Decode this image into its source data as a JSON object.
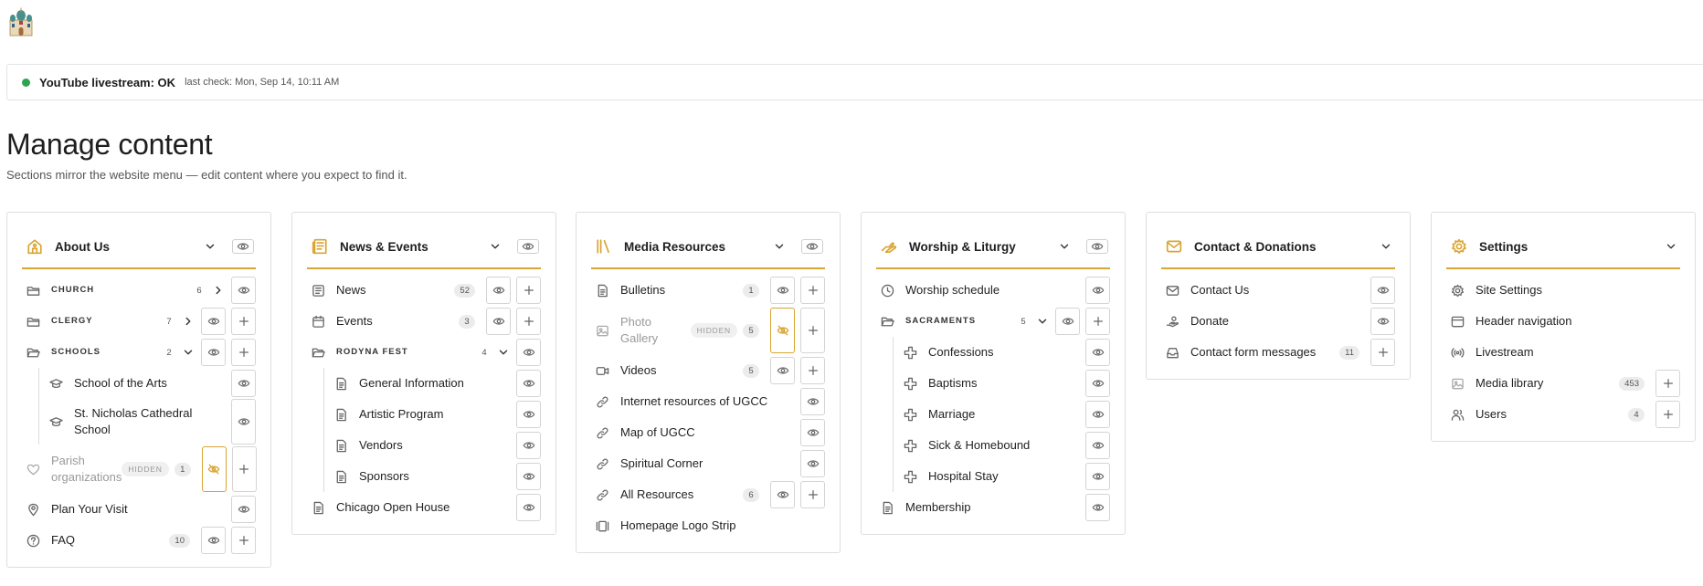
{
  "status": {
    "main": "YouTube livestream: OK",
    "sub": "last check: Mon, Sep 14, 10:11 AM"
  },
  "page": {
    "title": "Manage content",
    "subtitle": "Sections mirror the website menu — edit content where you expect to find it."
  },
  "colors": {
    "accent": "#d9a534",
    "status_ok": "#2ea44f"
  },
  "cards": {
    "about": {
      "title": "About Us",
      "church": {
        "label": "CHURCH",
        "count": "6"
      },
      "clergy": {
        "label": "CLERGY",
        "count": "7"
      },
      "schools": {
        "label": "SCHOOLS",
        "count": "2"
      },
      "arts": "School of the Arts",
      "cathedral": "St. Nicholas Cathedral School",
      "parish": {
        "label": "Parish organizations",
        "badge": "HIDDEN",
        "count": "1"
      },
      "visit": "Plan Your Visit",
      "faq": {
        "label": "FAQ",
        "count": "10"
      }
    },
    "news": {
      "title": "News & Events",
      "news": {
        "label": "News",
        "count": "52"
      },
      "events": {
        "label": "Events",
        "count": "3"
      },
      "rodyna": {
        "label": "RODYNA FEST",
        "count": "4"
      },
      "general": "General Information",
      "artistic": "Artistic Program",
      "vendors": "Vendors",
      "sponsors": "Sponsors",
      "chicago": "Chicago Open House"
    },
    "media": {
      "title": "Media Resources",
      "bulletins": {
        "label": "Bulletins",
        "count": "1"
      },
      "photo": {
        "label": "Photo Gallery",
        "badge": "HIDDEN",
        "count": "5"
      },
      "videos": {
        "label": "Videos",
        "count": "5"
      },
      "internet": "Internet resources of UGCC",
      "map": "Map of UGCC",
      "spiritual": "Spiritual Corner",
      "all": {
        "label": "All Resources",
        "count": "6"
      },
      "logo": "Homepage Logo Strip"
    },
    "worship": {
      "title": "Worship & Liturgy",
      "schedule": "Worship schedule",
      "sacraments": {
        "label": "SACRAMENTS",
        "count": "5"
      },
      "confessions": "Confessions",
      "baptisms": "Baptisms",
      "marriage": "Marriage",
      "sick": "Sick & Homebound",
      "hospital": "Hospital Stay",
      "membership": "Membership"
    },
    "contact": {
      "title": "Contact & Donations",
      "contact_us": "Contact Us",
      "donate": "Donate",
      "messages": {
        "label": "Contact form messages",
        "count": "11"
      }
    },
    "settings": {
      "title": "Settings",
      "site": "Site Settings",
      "header": "Header navigation",
      "livestream": "Livestream",
      "media": {
        "label": "Media library",
        "count": "453"
      },
      "users": {
        "label": "Users",
        "count": "4"
      }
    }
  }
}
